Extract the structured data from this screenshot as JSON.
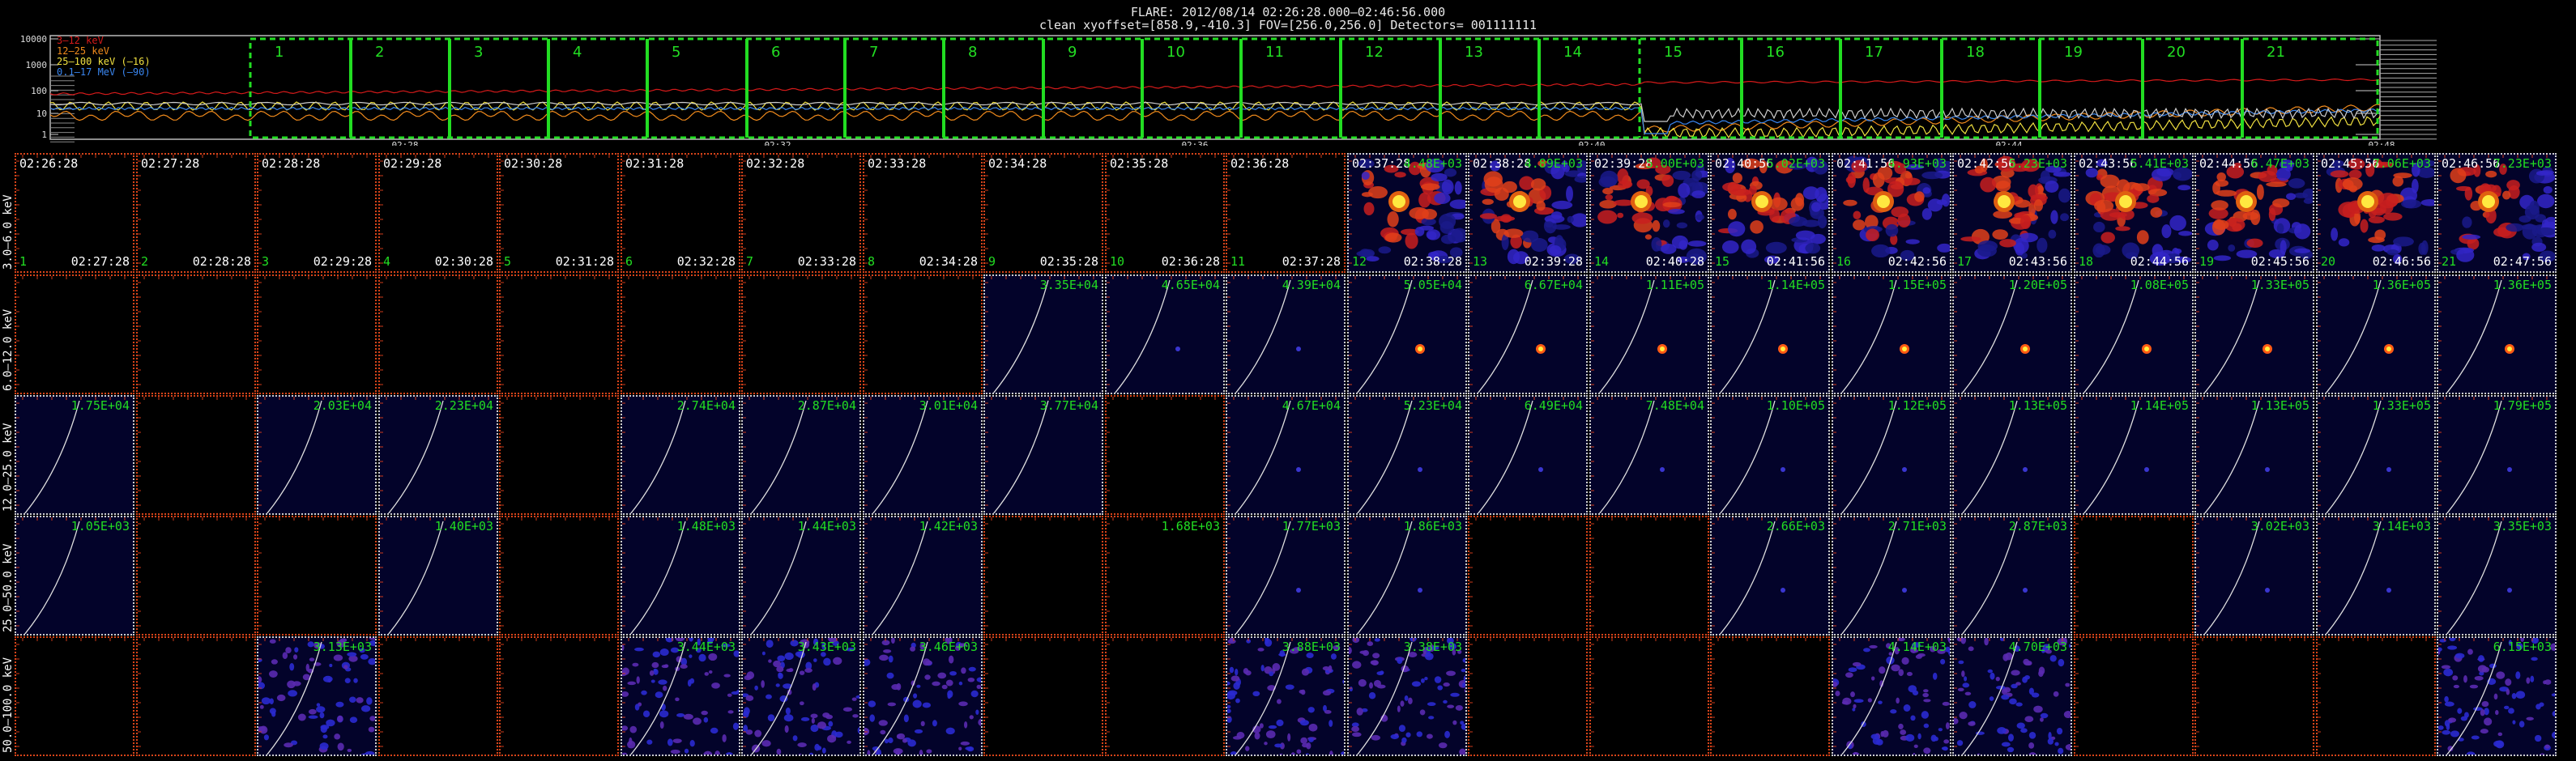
{
  "header": {
    "title": "FLARE: 2012/08/14  02:26:28.000—02:46:56.000",
    "subtitle": "clean    xyoffset=[858.9,-410.3]    FOV=[256.0,256.0]    Detectors= 001111111"
  },
  "lightcurve": {
    "y_ticks": [
      "10000",
      "1000",
      "100",
      "10",
      "1"
    ],
    "x_ticks": [
      "02:28",
      "02:32",
      "02:36",
      "02:40",
      "02:44",
      "02:48"
    ],
    "legend": [
      {
        "label": "3–12 keV",
        "color": "#d61a1a"
      },
      {
        "label": "12–25 keV",
        "color": "#f08a1c"
      },
      {
        "label": "25–100 keV (–16)",
        "color": "#f0e040"
      },
      {
        "label": "0.1–17 MeV (–90)",
        "color": "#3a86f0"
      }
    ],
    "interval_labels": [
      "1",
      "2",
      "3",
      "4",
      "5",
      "6",
      "7",
      "8",
      "9",
      "10",
      "11",
      "12",
      "13",
      "14",
      "15",
      "16",
      "17",
      "18",
      "19",
      "20",
      "21"
    ],
    "interval_color": "#22dd22"
  },
  "rows": [
    {
      "label": "3.0–6.0 keV"
    },
    {
      "label": "6.0–12.0 keV"
    },
    {
      "label": "12.0–25.0 keV"
    },
    {
      "label": "25.0–50.0 keV"
    },
    {
      "label": "50.0–100.0 keV"
    }
  ],
  "start_times": [
    "02:26:28",
    "02:27:28",
    "02:28:28",
    "02:29:28",
    "02:30:28",
    "02:31:28",
    "02:32:28",
    "02:33:28",
    "02:34:28",
    "02:35:28",
    "02:36:28",
    "02:37:28",
    "02:38:28",
    "02:39:28",
    "02:40:56",
    "02:41:56",
    "02:42:56",
    "02:43:56",
    "02:44:56",
    "02:45:56",
    "02:46:56"
  ],
  "end_times": [
    "02:27:28",
    "02:28:28",
    "02:29:28",
    "02:30:28",
    "02:31:28",
    "02:32:28",
    "02:33:28",
    "02:34:28",
    "02:35:28",
    "02:36:28",
    "02:37:28",
    "02:38:28",
    "02:39:28",
    "02:40:28",
    "02:41:56",
    "02:42:56",
    "02:43:56",
    "02:44:56",
    "02:45:56",
    "02:46:56",
    "02:47:56"
  ],
  "panel_values": [
    [
      "",
      "",
      "",
      "",
      "",
      "",
      "",
      "",
      "",
      "",
      "",
      "4.48E+03",
      "4.89E+03",
      "5.00E+03",
      "5.02E+03",
      "4.93E+03",
      "5.23E+03",
      "5.41E+03",
      "6.47E+03",
      "7.06E+03",
      "7.23E+03"
    ],
    [
      "",
      "",
      "",
      "",
      "",
      "",
      "",
      "",
      "3.35E+04",
      "4.65E+04",
      "4.39E+04",
      "5.05E+04",
      "6.67E+04",
      "1.11E+05",
      "1.14E+05",
      "1.15E+05",
      "1.20E+05",
      "1.08E+05",
      "1.33E+05",
      "1.36E+05",
      "1.36E+05"
    ],
    [
      "1.75E+04",
      "",
      "2.03E+04",
      "2.23E+04",
      "",
      "2.74E+04",
      "2.87E+04",
      "3.01E+04",
      "3.77E+04",
      "",
      "4.67E+04",
      "5.23E+04",
      "6.49E+04",
      "7.48E+04",
      "1.10E+05",
      "1.12E+05",
      "1.13E+05",
      "1.14E+05",
      "1.13E+05",
      "1.33E+05",
      "1.79E+05"
    ],
    [
      "1.05E+03",
      "",
      "",
      "1.40E+03",
      "",
      "1.48E+03",
      "1.44E+03",
      "1.42E+03",
      "",
      "1.68E+03",
      "1.77E+03",
      "1.86E+03",
      "",
      "",
      "2.66E+03",
      "2.71E+03",
      "2.87E+03",
      "",
      "3.02E+03",
      "3.14E+03",
      "3.35E+03"
    ],
    [
      "",
      "",
      "3.13E+03",
      "",
      "",
      "3.44E+03",
      "3.43E+03",
      "3.46E+03",
      "",
      "",
      "3.88E+03",
      "3.38E+03",
      "",
      "",
      "",
      "4.14E+03",
      "4.70E+03",
      "",
      "",
      "",
      "6.15E+03"
    ]
  ],
  "panel_types": [
    "BBBBBBBBBBBFFFFFFFFFF",
    "BBBBBBBBDDDEEEEEEEEEE",
    "DBDDBDDDDXDDDDDDDDDDD",
    "DBBDBDDDBBDDBBDDDBDDD",
    "BBNBBNNNBBNNBBBNNBBBN"
  ],
  "colors": {
    "background": "#000000",
    "panel_bg": "#03032a",
    "border_active": "#cfcfcf",
    "border_empty": "#d8441a",
    "time_text": "#ffffff",
    "index_text": "#22dd22",
    "value_text": "#22dd22"
  }
}
